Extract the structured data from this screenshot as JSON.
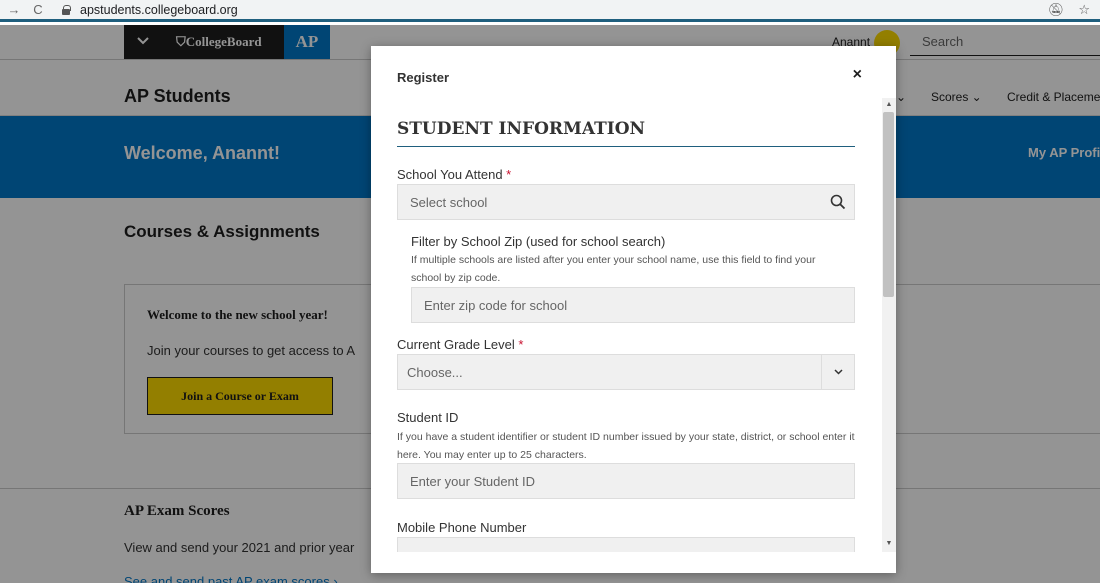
{
  "browser": {
    "url": "apstudents.collegeboard.org"
  },
  "topbar": {
    "logo": "CollegeBoard",
    "ap_logo": "AP",
    "user_name": "Anannt",
    "search_placeholder": "Search"
  },
  "header": {
    "title": "AP Students",
    "nav": [
      {
        "label": "Scores ⌄"
      },
      {
        "label": "Credit & Placeme"
      }
    ]
  },
  "welcome": {
    "text": "Welcome, Anannt!",
    "profile_link": "My AP Profi"
  },
  "courses": {
    "heading": "Courses & Assignments",
    "card_title": "Welcome to the new school year!",
    "card_text": "Join your courses to get access to A",
    "join_button": "Join a Course or Exam"
  },
  "scores": {
    "heading": "AP Exam Scores",
    "text": "View and send your 2021 and prior year",
    "link": "See and send past AP exam scores  ›"
  },
  "modal": {
    "title": "Register",
    "close": "×",
    "heading": "STUDENT INFORMATION",
    "school": {
      "label": "School You Attend",
      "placeholder": "Select school"
    },
    "zip": {
      "label": "Filter by School Zip (used for school search)",
      "hint": "If multiple schools are listed after you enter your school name, use this field to find your school by zip code.",
      "placeholder": "Enter zip code for school"
    },
    "grade": {
      "label": "Current Grade Level",
      "value": "Choose..."
    },
    "student_id": {
      "label": "Student ID",
      "hint": "If you have a student identifier or student ID number issued by your state, district, or school enter it here. You may enter up to 25 characters.",
      "placeholder": "Enter your Student ID"
    },
    "phone": {
      "label": "Mobile Phone Number"
    },
    "required_mark": "*"
  }
}
